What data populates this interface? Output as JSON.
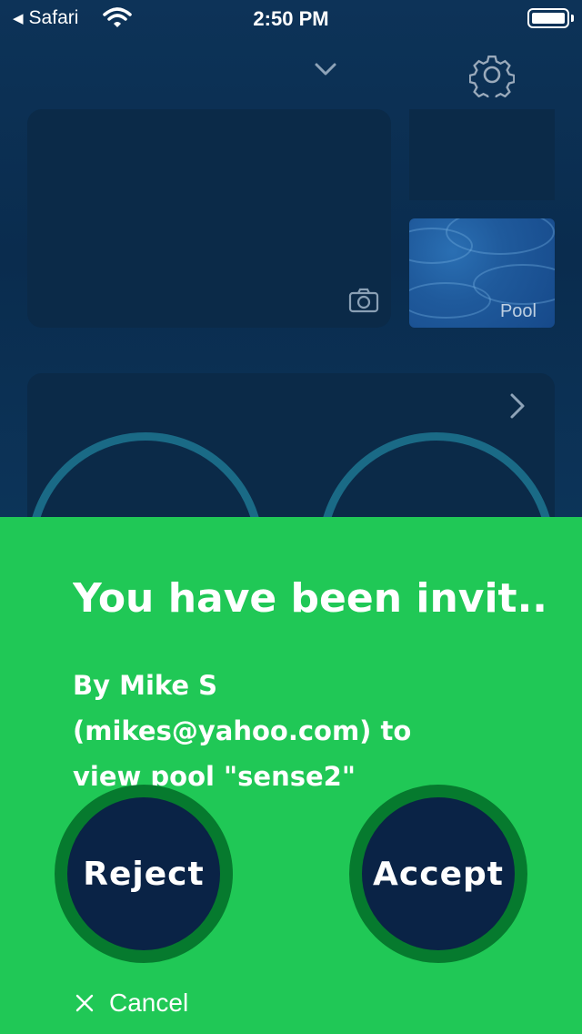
{
  "status_bar": {
    "back_app": "Safari",
    "time": "2:50 PM"
  },
  "header": {
    "dropdown_icon": "chevron-down-icon",
    "settings_icon": "gear-icon"
  },
  "pool_tile": {
    "label": "Pool"
  },
  "invite_sheet": {
    "title": "You have been invit...",
    "body_line1": "By Mike S",
    "body_line2": "(mikes@yahoo.com) to",
    "body_line3": "view pool \"sense2\"",
    "reject_label": "Reject",
    "accept_label": "Accept",
    "cancel_label": "Cancel"
  },
  "colors": {
    "app_background": "#0b2c4c",
    "sheet_green": "#20c856",
    "button_ring": "#067a2e",
    "button_fill": "#0a2346"
  }
}
